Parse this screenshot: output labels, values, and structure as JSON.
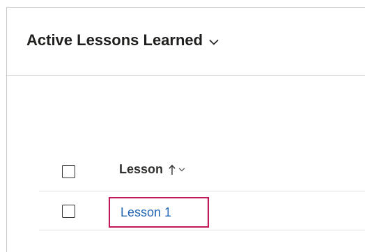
{
  "view": {
    "title": "Active Lessons Learned",
    "chevron_icon": "chevron-down-icon"
  },
  "grid": {
    "columns": [
      {
        "label": "Lesson",
        "sort": "ascending",
        "sort_icon": "arrow-up-icon",
        "menu_icon": "chevron-down-icon"
      }
    ],
    "rows": [
      {
        "lesson": "Lesson 1",
        "selected": false,
        "highlighted": true
      }
    ]
  },
  "colors": {
    "link": "#2266b3",
    "highlight_border": "#c2185b",
    "text": "#323130"
  }
}
